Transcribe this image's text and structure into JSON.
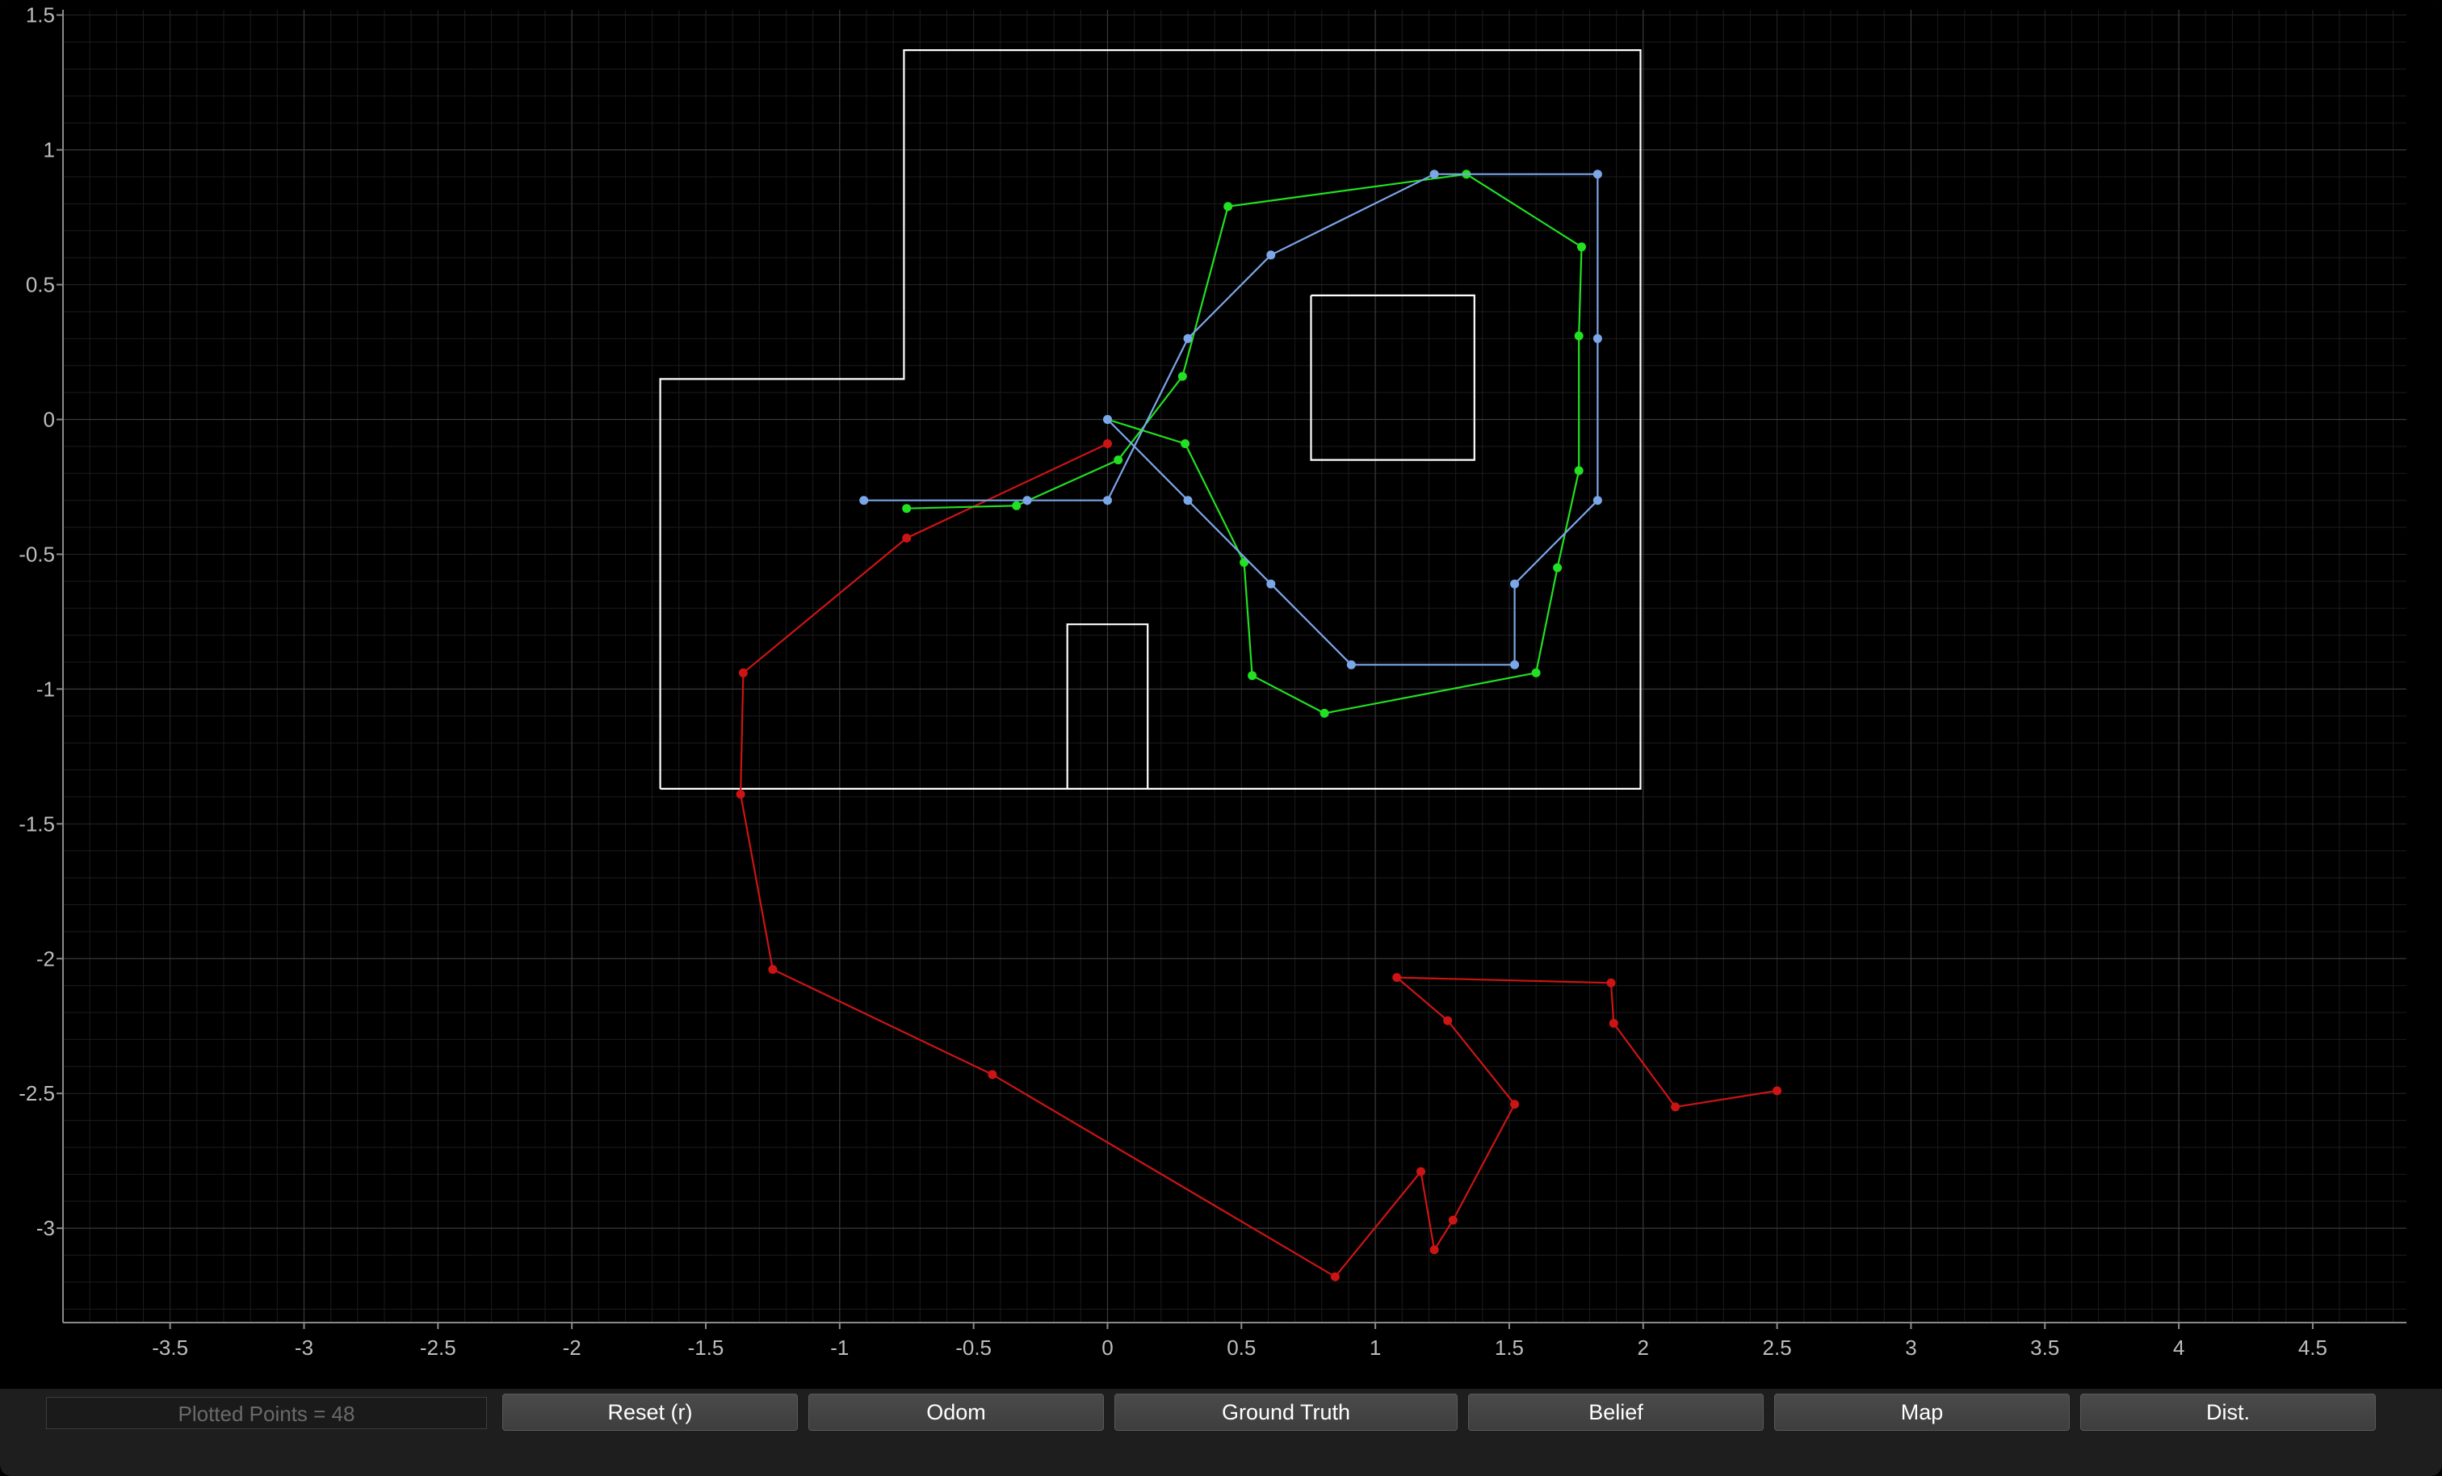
{
  "colors": {
    "background": "#000000",
    "grid_major": "#3a3a3a",
    "grid_minor": "#1c1c1c",
    "axis_text": "#bdbdbd",
    "map": "#ffffff",
    "odom": "#cc1414",
    "ground_truth": "#22e022",
    "belief": "#7ba6e8"
  },
  "chart_data": {
    "type": "line",
    "xlim": [
      -3.9,
      4.85
    ],
    "ylim": [
      -3.35,
      1.52
    ],
    "grid": true,
    "x_ticks": [
      -3.5,
      -3,
      -2.5,
      -2,
      -1.5,
      -1,
      -0.5,
      0,
      0.5,
      1,
      1.5,
      2,
      2.5,
      3,
      3.5,
      4,
      4.5
    ],
    "x_tick_labels": [
      "-3.5",
      "-3",
      "-2.5",
      "-2",
      "-1.5",
      "-1",
      "-0.5",
      "0",
      "0.5",
      "1",
      "1.5",
      "2",
      "2.5",
      "3",
      "3.5",
      "4",
      "4.5"
    ],
    "y_ticks": [
      1.5,
      1,
      0.5,
      0,
      -0.5,
      -1,
      -1.5,
      -2,
      -2.5,
      -3
    ],
    "y_tick_labels": [
      "1.5",
      "1",
      "0.5",
      "0",
      "-0.5",
      "-1",
      "-1.5",
      "-2",
      "-2.5",
      "-3"
    ],
    "series": [
      {
        "key": "map",
        "color": "#ffffff",
        "markers": false,
        "segments": [
          [
            [
              -1.67,
              -1.37
            ],
            [
              1.99,
              -1.37
            ],
            [
              1.99,
              1.37
            ],
            [
              -0.76,
              1.37
            ],
            [
              -0.76,
              0.15
            ],
            [
              -1.67,
              0.15
            ],
            [
              -1.67,
              -1.37
            ]
          ],
          [
            [
              0.76,
              0.46
            ],
            [
              1.37,
              0.46
            ],
            [
              1.37,
              -0.15
            ],
            [
              0.76,
              -0.15
            ],
            [
              0.76,
              0.46
            ]
          ],
          [
            [
              -0.15,
              -1.37
            ],
            [
              -0.15,
              -0.76
            ],
            [
              0.15,
              -0.76
            ],
            [
              0.15,
              -1.37
            ]
          ]
        ]
      },
      {
        "key": "odom",
        "color": "#cc1414",
        "markers": true,
        "points": [
          [
            0,
            -0.09
          ],
          [
            -0.75,
            -0.44
          ],
          [
            -1.36,
            -0.94
          ],
          [
            -1.37,
            -1.39
          ],
          [
            -1.25,
            -2.04
          ],
          [
            -0.43,
            -2.43
          ],
          [
            0.85,
            -3.18
          ],
          [
            1.17,
            -2.79
          ],
          [
            1.22,
            -3.08
          ],
          [
            1.29,
            -2.97
          ],
          [
            1.52,
            -2.54
          ],
          [
            1.27,
            -2.23
          ],
          [
            1.08,
            -2.07
          ],
          [
            1.88,
            -2.09
          ],
          [
            1.89,
            -2.24
          ],
          [
            2.12,
            -2.55
          ],
          [
            2.5,
            -2.49
          ]
        ]
      },
      {
        "key": "ground_truth",
        "color": "#22e022",
        "markers": true,
        "points": [
          [
            -0.75,
            -0.33
          ],
          [
            -0.34,
            -0.32
          ],
          [
            0.04,
            -0.15
          ],
          [
            0.28,
            0.16
          ],
          [
            0.45,
            0.79
          ],
          [
            1.34,
            0.91
          ],
          [
            1.77,
            0.64
          ],
          [
            1.76,
            0.31
          ],
          [
            1.76,
            -0.19
          ],
          [
            1.68,
            -0.55
          ],
          [
            1.6,
            -0.94
          ],
          [
            0.81,
            -1.09
          ],
          [
            0.54,
            -0.95
          ],
          [
            0.51,
            -0.53
          ],
          [
            0.29,
            -0.09
          ],
          [
            0,
            0
          ]
        ]
      },
      {
        "key": "belief",
        "color": "#7ba6e8",
        "markers": true,
        "points": [
          [
            -0.91,
            -0.3
          ],
          [
            -0.3,
            -0.3
          ],
          [
            0,
            -0.3
          ],
          [
            0.3,
            0.3
          ],
          [
            0.61,
            0.61
          ],
          [
            1.22,
            0.91
          ],
          [
            1.83,
            0.91
          ],
          [
            1.83,
            0.3
          ],
          [
            1.83,
            -0.3
          ],
          [
            1.52,
            -0.61
          ],
          [
            1.52,
            -0.91
          ],
          [
            0.91,
            -0.91
          ],
          [
            0.61,
            -0.61
          ],
          [
            0.3,
            -0.3
          ],
          [
            0,
            0
          ]
        ]
      }
    ]
  },
  "toolbar": {
    "plotted_points": "Plotted Points = 48",
    "reset_label": "Reset (r)",
    "odom_label": "Odom",
    "ground_truth_label": "Ground Truth",
    "belief_label": "Belief",
    "map_label": "Map",
    "dist_label": "Dist."
  }
}
